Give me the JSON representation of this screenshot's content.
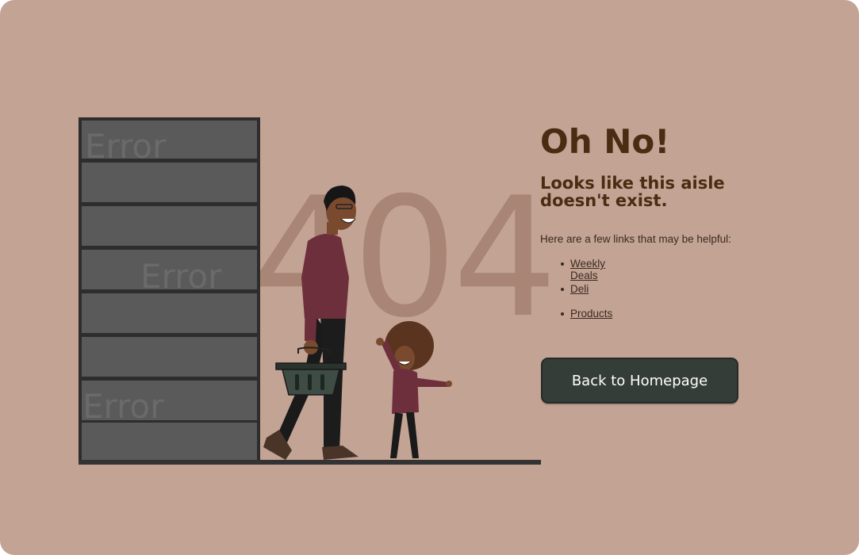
{
  "illustration": {
    "big_number": "404",
    "shelf_label": "Error"
  },
  "content": {
    "heading": "Oh No!",
    "subheading": "Looks like this aisle doesn't exist.",
    "helper_text": "Here are a few links that may be helpful:",
    "links": [
      {
        "label": "Weekly Deals"
      },
      {
        "label": "Deli"
      },
      {
        "label": "Products"
      }
    ],
    "home_button": "Back to Homepage"
  },
  "colors": {
    "background": "#c2a394",
    "heading": "#4a2c12",
    "button": "#353d38",
    "shelf": "#5a5a5a"
  }
}
